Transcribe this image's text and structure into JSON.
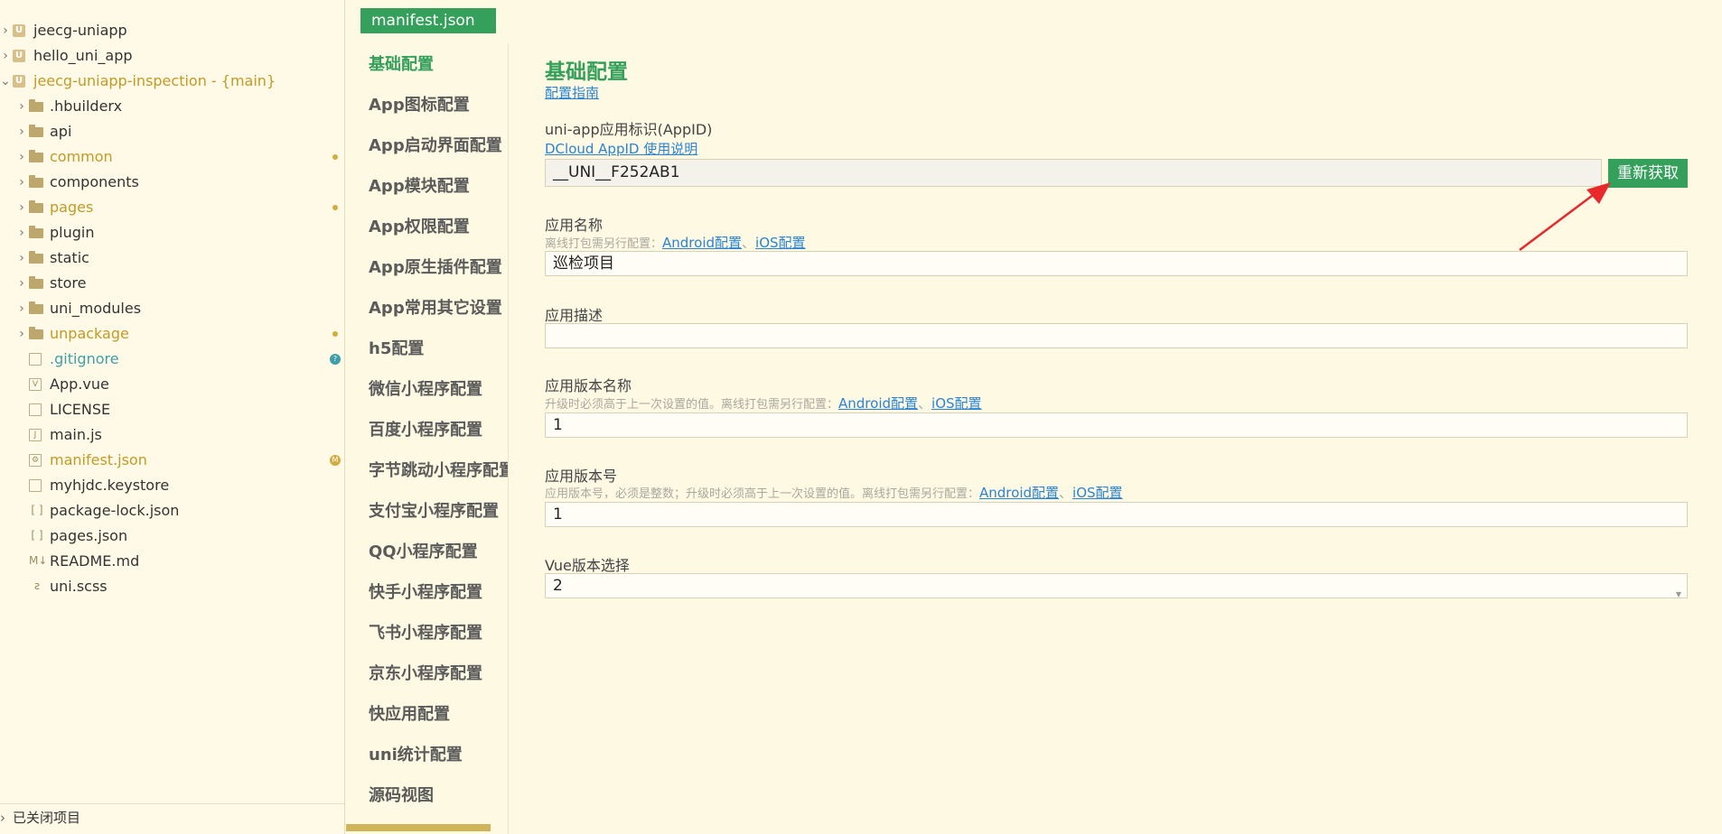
{
  "explorer": {
    "items": [
      {
        "label": "jeecg-uniapp",
        "type": "project",
        "level": 0,
        "chev": "›"
      },
      {
        "label": "hello_uni_app",
        "type": "project",
        "level": 0,
        "chev": "›"
      },
      {
        "label": "jeecg-uniapp-inspection - {main}",
        "type": "project",
        "level": 0,
        "chev": "⌄",
        "status": "modified-text"
      },
      {
        "label": ".hbuilderx",
        "type": "folder",
        "level": 1,
        "chev": "›"
      },
      {
        "label": "api",
        "type": "folder",
        "level": 1,
        "chev": "›"
      },
      {
        "label": "common",
        "type": "folder",
        "level": 1,
        "chev": "›",
        "status": "modified"
      },
      {
        "label": "components",
        "type": "folder",
        "level": 1,
        "chev": "›"
      },
      {
        "label": "pages",
        "type": "folder",
        "level": 1,
        "chev": "›",
        "status": "modified"
      },
      {
        "label": "plugin",
        "type": "folder",
        "level": 1,
        "chev": "›"
      },
      {
        "label": "static",
        "type": "folder",
        "level": 1,
        "chev": "›"
      },
      {
        "label": "store",
        "type": "folder",
        "level": 1,
        "chev": "›"
      },
      {
        "label": "uni_modules",
        "type": "folder",
        "level": 1,
        "chev": "›"
      },
      {
        "label": "unpackage",
        "type": "folder",
        "level": 1,
        "chev": "›",
        "status": "modified"
      },
      {
        "label": ".gitignore",
        "type": "file",
        "level": 1,
        "status": "untracked",
        "glyph": ""
      },
      {
        "label": "App.vue",
        "type": "file",
        "level": 1,
        "glyph": "V"
      },
      {
        "label": "LICENSE",
        "type": "file",
        "level": 1,
        "glyph": ""
      },
      {
        "label": "main.js",
        "type": "file",
        "level": 1,
        "glyph": "J"
      },
      {
        "label": "manifest.json",
        "type": "file",
        "level": 1,
        "status": "M",
        "glyph": "⚙"
      },
      {
        "label": "myhjdc.keystore",
        "type": "file",
        "level": 1,
        "glyph": ""
      },
      {
        "label": "package-lock.json",
        "type": "json",
        "level": 1,
        "glyph": "[ ]"
      },
      {
        "label": "pages.json",
        "type": "json",
        "level": 1,
        "glyph": "[ ]"
      },
      {
        "label": "README.md",
        "type": "md",
        "level": 1,
        "glyph": "M↓"
      },
      {
        "label": "uni.scss",
        "type": "scss",
        "level": 1,
        "glyph": "ƨ"
      }
    ],
    "closed_projects": "已关闭项目"
  },
  "tab": {
    "label": "manifest.json"
  },
  "nav": {
    "items": [
      "基础配置",
      "App图标配置",
      "App启动界面配置",
      "App模块配置",
      "App权限配置",
      "App原生插件配置",
      "App常用其它设置",
      "h5配置",
      "微信小程序配置",
      "百度小程序配置",
      "字节跳动小程序配置",
      "支付宝小程序配置",
      "QQ小程序配置",
      "快手小程序配置",
      "飞书小程序配置",
      "京东小程序配置",
      "快应用配置",
      "uni统计配置",
      "源码视图"
    ]
  },
  "form": {
    "title": "基础配置",
    "guide_link": "配置指南",
    "appid": {
      "label": "uni-app应用标识(AppID)",
      "help_link": "DCloud AppID 使用说明",
      "value": "__UNI__F252AB1",
      "refresh_button": "重新获取"
    },
    "name": {
      "label": "应用名称",
      "hint": "离线打包需另行配置：",
      "android_link": "Android配置",
      "sep": "、",
      "ios_link": "iOS配置",
      "value": "巡检项目"
    },
    "desc": {
      "label": "应用描述",
      "value": ""
    },
    "version_name": {
      "label": "应用版本名称",
      "hint": "升级时必须高于上一次设置的值。离线打包需另行配置：",
      "android_link": "Android配置",
      "sep": "、",
      "ios_link": "iOS配置",
      "value": "1"
    },
    "version_code": {
      "label": "应用版本号",
      "hint": "应用版本号，必须是整数；升级时必须高于上一次设置的值。离线打包需另行配置：",
      "android_link": "Android配置",
      "sep": "、",
      "ios_link": "iOS配置",
      "value": "1"
    },
    "vue_version": {
      "label": "Vue版本选择",
      "value": "2"
    }
  },
  "colors": {
    "accent": "#35a05b",
    "link": "#2b84d3",
    "modified": "#c39a25",
    "annotation_arrow": "#e8282b"
  }
}
